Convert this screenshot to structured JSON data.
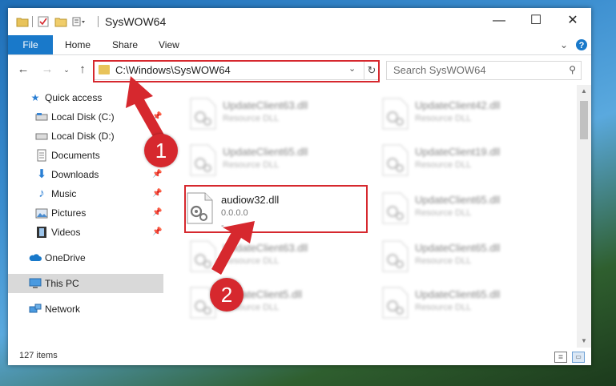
{
  "window": {
    "title": "SysWOW64",
    "controls": {
      "minimize": "—",
      "maximize": "☐",
      "close": "✕"
    }
  },
  "ribbon": {
    "tabs": [
      "File",
      "Home",
      "Share",
      "View"
    ],
    "collapse_icon": "chevron-down-icon",
    "help_icon": "help-icon"
  },
  "navigation": {
    "address": "C:\\Windows\\SysWOW64",
    "search_placeholder": "Search SysWOW64"
  },
  "sidebar": {
    "items": [
      {
        "label": "Quick access",
        "icon": "star-icon"
      },
      {
        "label": "Local Disk (C:)",
        "icon": "drive-icon"
      },
      {
        "label": "Local Disk (D:)",
        "icon": "drive-icon"
      },
      {
        "label": "Documents",
        "icon": "documents-icon"
      },
      {
        "label": "Downloads",
        "icon": "download-icon"
      },
      {
        "label": "Music",
        "icon": "music-icon"
      },
      {
        "label": "Pictures",
        "icon": "pictures-icon"
      },
      {
        "label": "Videos",
        "icon": "videos-icon"
      },
      {
        "label": "OneDrive",
        "icon": "cloud-icon"
      },
      {
        "label": "This PC",
        "icon": "computer-icon"
      },
      {
        "label": "Network",
        "icon": "network-icon"
      }
    ]
  },
  "files": {
    "left": [
      {
        "name": "UpdateClient63.dll",
        "desc": "Resource DLL"
      },
      {
        "name": "UpdateClient65.dll",
        "desc": "Resource DLL"
      },
      {
        "name": "audiow32.dll",
        "desc": "0.0.0.0",
        "extra": "-"
      },
      {
        "name": "UpdateClient63.dll",
        "desc": "Resource DLL"
      },
      {
        "name": "UpdateClient5.dll",
        "desc": "Resource DLL"
      }
    ],
    "right": [
      {
        "name": "UpdateClient42.dll",
        "desc": "Resource DLL"
      },
      {
        "name": "UpdateClient19.dll",
        "desc": "Resource DLL"
      },
      {
        "name": "UpdateClient65.dll",
        "desc": "Resource DLL"
      },
      {
        "name": "UpdateClient65.dll",
        "desc": "Resource DLL"
      },
      {
        "name": "UpdateClient65.dll",
        "desc": "Resource DLL"
      }
    ]
  },
  "status": {
    "item_count": "127 items"
  },
  "annotations": {
    "step1": "1",
    "step2": "2",
    "color": "#d6282e"
  }
}
